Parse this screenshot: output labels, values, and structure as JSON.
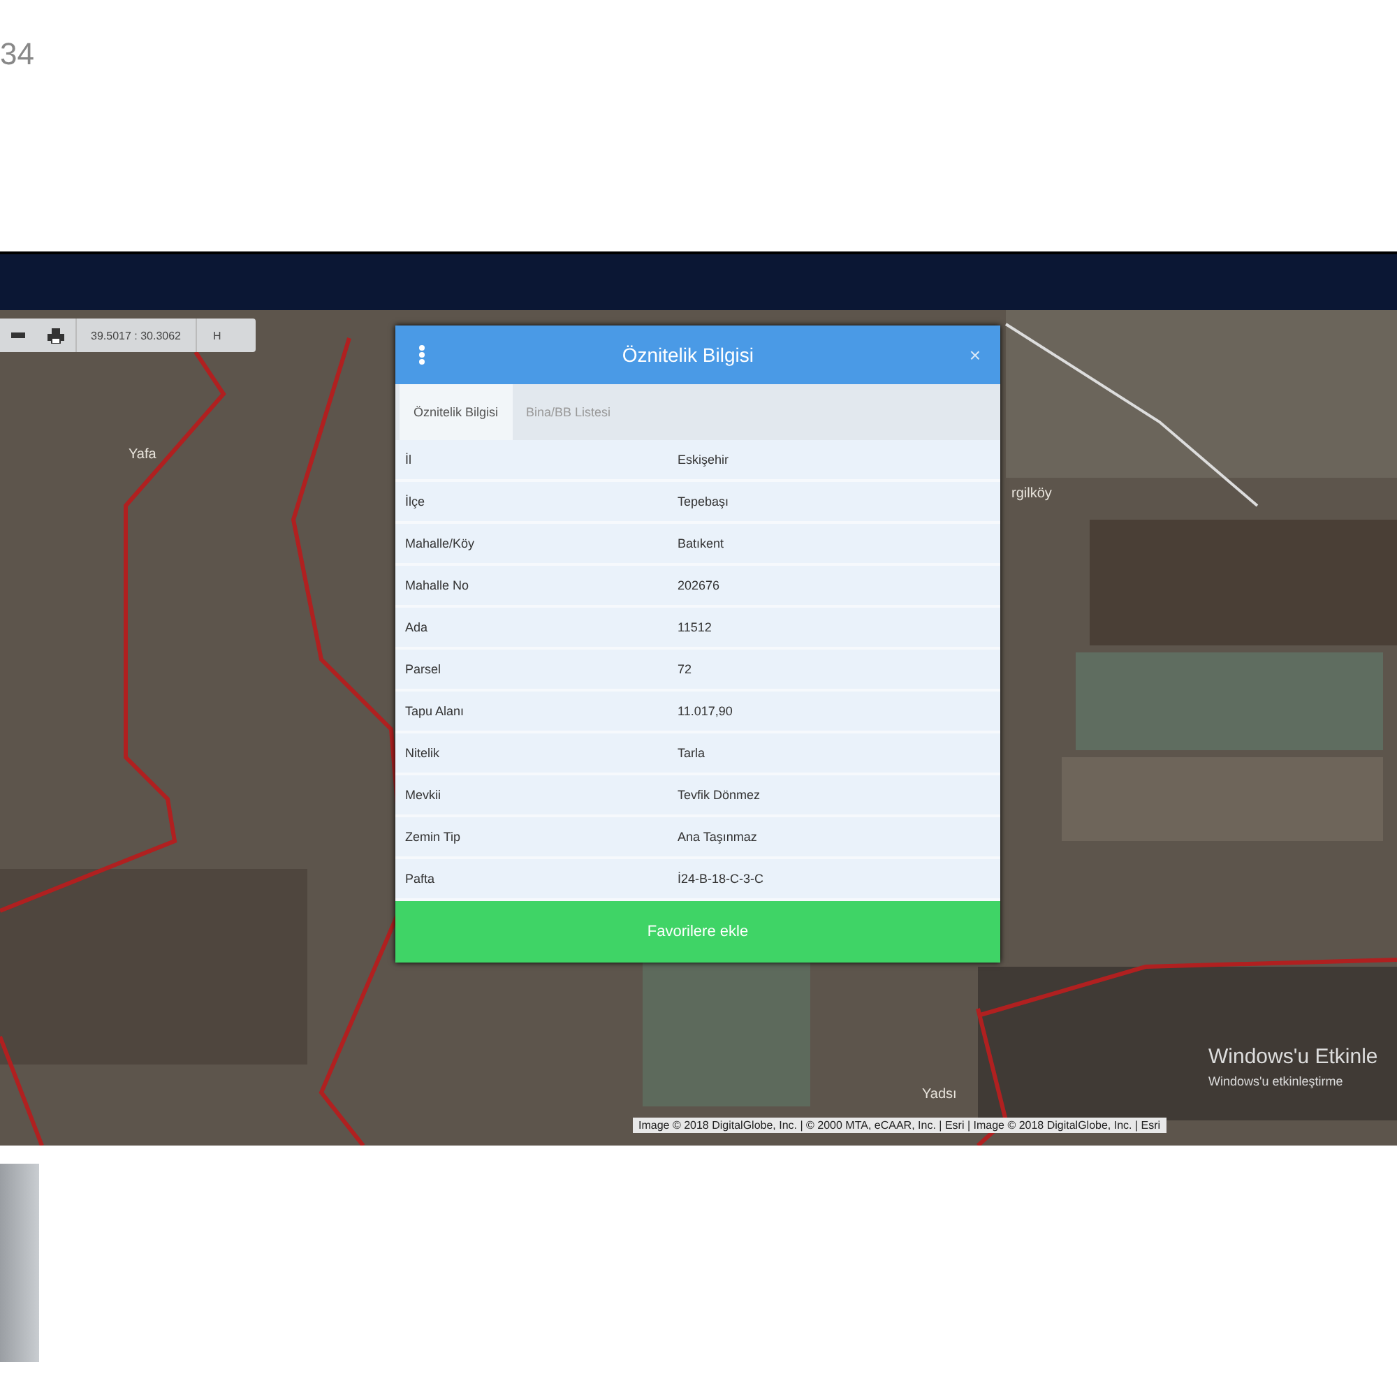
{
  "page_number": "34",
  "map_toolbar": {
    "coordinates": "39.5017 : 30.3062",
    "button_label": "H"
  },
  "map_labels": [
    {
      "text": "Yafa",
      "kind": "place"
    },
    {
      "text": "rgilköy",
      "kind": "place"
    },
    {
      "text": "Yadsı",
      "kind": "place"
    }
  ],
  "dialog": {
    "title": "Öznitelik Bilgisi",
    "tabs": [
      {
        "label": "Öznitelik Bilgisi",
        "selected": true
      },
      {
        "label": "Bina/BB Listesi",
        "selected": false
      }
    ],
    "rows": [
      {
        "label": "İl",
        "value": "Eskişehir"
      },
      {
        "label": "İlçe",
        "value": "Tepebaşı"
      },
      {
        "label": "Mahalle/Köy",
        "value": "Batıkent"
      },
      {
        "label": "Mahalle No",
        "value": "202676"
      },
      {
        "label": "Ada",
        "value": "11512"
      },
      {
        "label": "Parsel",
        "value": "72"
      },
      {
        "label": "Tapu Alanı",
        "value": "11.017,90"
      },
      {
        "label": "Nitelik",
        "value": "Tarla"
      },
      {
        "label": "Mevkii",
        "value": "Tevfik Dönmez"
      },
      {
        "label": "Zemin Tip",
        "value": "Ana Taşınmaz"
      },
      {
        "label": "Pafta",
        "value": "İ24-B-18-C-3-C"
      }
    ],
    "button": "Favorilere ekle",
    "close_glyph": "×"
  },
  "activation_notice": {
    "title": "Windows'u Etkinle",
    "subtitle": "Windows'u etkinleştirme"
  },
  "attribution": "Image © 2018 DigitalGlobe, Inc. | © 2000 MTA, eCAAR, Inc. | Esri | Image © 2018 DigitalGlobe, Inc. | Esri"
}
